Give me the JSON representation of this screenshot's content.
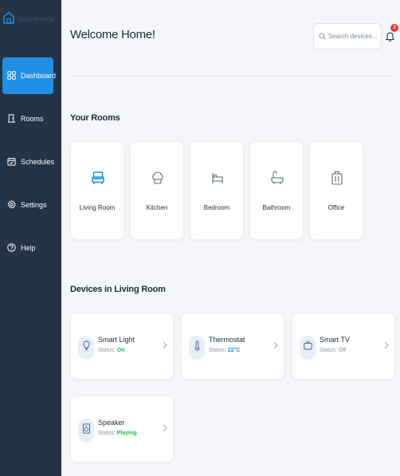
{
  "app": {
    "name": "SmartHome"
  },
  "sidebar": {
    "items": [
      {
        "label": "Dashboard",
        "icon": "dashboard-icon",
        "active": true
      },
      {
        "label": "Rooms",
        "icon": "door-icon"
      },
      {
        "label": "Schedules",
        "icon": "calendar-icon"
      },
      {
        "label": "Settings",
        "icon": "gear-icon"
      },
      {
        "label": "Help",
        "icon": "help-icon"
      }
    ]
  },
  "header": {
    "title": "Welcome Home!",
    "search_placeholder": "Search devices...",
    "notification_count": "3"
  },
  "rooms": {
    "section_title": "Your Rooms",
    "items": [
      {
        "label": "Living Room",
        "icon": "sofa-icon",
        "selected": true
      },
      {
        "label": "Kitchen",
        "icon": "chef-hat-icon"
      },
      {
        "label": "Bedroom",
        "icon": "bed-icon"
      },
      {
        "label": "Bathroom",
        "icon": "bath-icon"
      },
      {
        "label": "Office",
        "icon": "briefcase-icon"
      }
    ]
  },
  "devices": {
    "section_title": "Devices in Living Room",
    "status_prefix": "Status:",
    "items": [
      {
        "name": "Smart Light",
        "status": "On",
        "status_color": "#1db954",
        "icon": "lightbulb-icon"
      },
      {
        "name": "Thermostat",
        "status": "22°C",
        "status_color": "#1f8fe6",
        "icon": "thermometer-icon"
      },
      {
        "name": "Smart TV",
        "status": "Off",
        "status_color": "#8a96a6",
        "icon": "tv-icon"
      },
      {
        "name": "Speaker",
        "status": "Playing",
        "status_color": "#1db954",
        "icon": "speaker-icon"
      }
    ]
  },
  "colors": {
    "sidebar_bg": "#243447",
    "accent": "#1f8fe6",
    "on": "#1db954",
    "badge": "#e53935"
  }
}
